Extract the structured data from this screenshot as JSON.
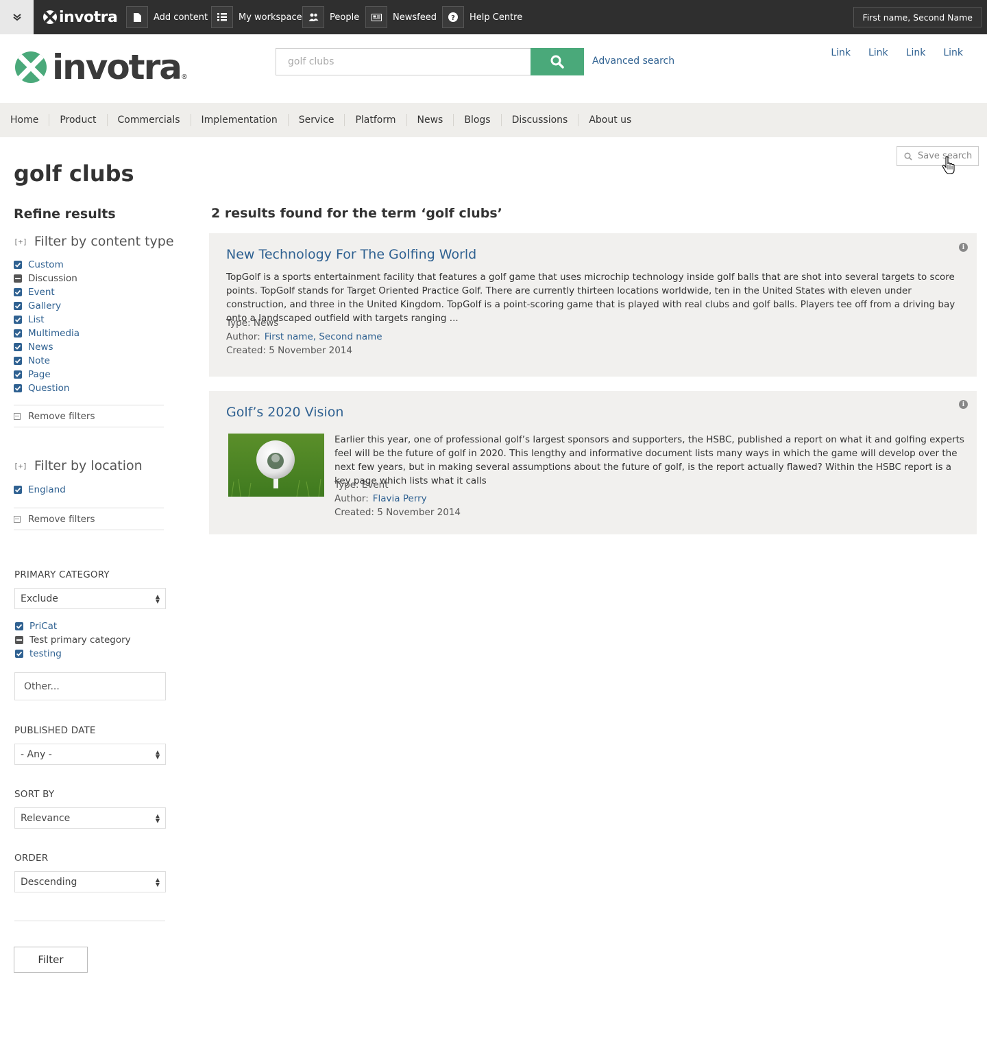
{
  "toolbar": {
    "logo": "invotra",
    "items": [
      {
        "label": "Add content",
        "icon": "document-icon"
      },
      {
        "label": "My workspace",
        "icon": "list-icon"
      },
      {
        "label": "People",
        "icon": "people-icon"
      },
      {
        "label": "Newsfeed",
        "icon": "newspaper-icon"
      },
      {
        "label": "Help Centre",
        "icon": "question-icon"
      }
    ],
    "user": "First name, Second Name"
  },
  "header": {
    "logo": "invotra",
    "search_value": "golf clubs",
    "advanced_search": "Advanced search",
    "links": [
      "Link",
      "Link",
      "Link",
      "Link"
    ]
  },
  "nav": [
    "Home",
    "Product",
    "Commercials",
    "Implementation",
    "Service",
    "Platform",
    "News",
    "Blogs",
    "Discussions",
    "About us"
  ],
  "page": {
    "title": "golf clubs",
    "save_search": "Save search"
  },
  "sidebar": {
    "refine": "Refine results",
    "content_type": {
      "heading": "Filter by content type",
      "toggle": "[+]",
      "items": [
        {
          "label": "Custom",
          "state": "on"
        },
        {
          "label": "Discussion",
          "state": "partial"
        },
        {
          "label": "Event",
          "state": "on"
        },
        {
          "label": "Gallery",
          "state": "on"
        },
        {
          "label": "List",
          "state": "on"
        },
        {
          "label": "Multimedia",
          "state": "on"
        },
        {
          "label": "News",
          "state": "on"
        },
        {
          "label": "Note",
          "state": "on"
        },
        {
          "label": "Page",
          "state": "on"
        },
        {
          "label": "Question",
          "state": "on"
        }
      ],
      "remove": "Remove filters"
    },
    "location": {
      "heading": "Filter by location",
      "toggle": "[+]",
      "items": [
        {
          "label": "England",
          "state": "on"
        }
      ],
      "remove": "Remove filters"
    },
    "primary_category": {
      "label": "PRIMARY CATEGORY",
      "select": "Exclude",
      "items": [
        {
          "label": "PriCat",
          "state": "on"
        },
        {
          "label": "Test primary category",
          "state": "partial"
        },
        {
          "label": "testing",
          "state": "on"
        }
      ],
      "other_placeholder": "Other..."
    },
    "published_date": {
      "label": "PUBLISHED DATE",
      "select": "- Any -"
    },
    "sort_by": {
      "label": "SORT BY",
      "select": "Relevance"
    },
    "order": {
      "label": "ORDER",
      "select": "Descending"
    },
    "filter_button": "Filter"
  },
  "results": {
    "heading": "2 results found for the term ‘golf clubs’",
    "items": [
      {
        "title": "New Technology For The Golfing World",
        "description": "TopGolf is a sports entertainment facility that features a golf game that uses microchip technology inside golf balls that are shot into several targets to score points. TopGolf stands for Target Oriented Practice Golf. There are currently thirteen locations worldwide, ten in the United States with eleven under construction, and three in the United Kingdom. TopGolf is a point-scoring game that is played with real clubs and golf balls. Players tee off from a driving bay onto a landscaped outfield with targets ranging ...",
        "type": "Type: News",
        "author_label": "Author:",
        "author": "First name, Second name",
        "created": "Created: 5 November 2014"
      },
      {
        "title": "Golf’s 2020 Vision",
        "description": "Earlier this year, one of professional golf’s largest sponsors and supporters, the HSBC, published a report on what it and golfing experts feel will be the future of golf in 2020. This lengthy and informative document lists many ways in which the game will develop over the next few years, but in making several assumptions about the future of golf, is the report actually flawed? Within the HSBC report is a key page which lists what it calls",
        "type": "Type: Event",
        "author_label": "Author:",
        "author": "Flavia Perry",
        "created": "Created: 5 November 2014"
      }
    ]
  },
  "colors": {
    "accent": "#4aa97a",
    "link": "#2f6191",
    "toolbar": "#2f2f2f",
    "nav": "#efeeeb",
    "card": "#f1f0ee"
  }
}
